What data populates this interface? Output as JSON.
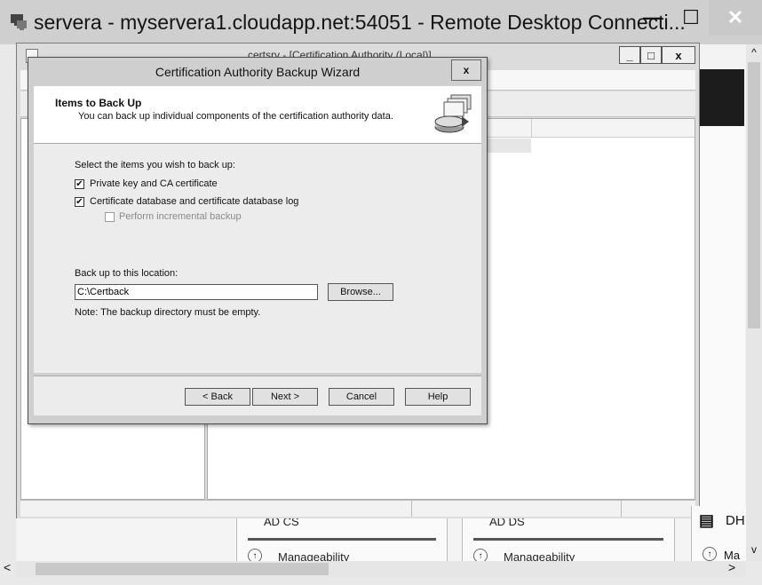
{
  "rdp_window": {
    "title": "servera - myservera1.cloudapp.net:54051 - Remote Desktop Connecti...",
    "min_glyph": "—",
    "max_glyph": "☐",
    "close_glyph": "✕"
  },
  "certsrv_window": {
    "title": "certsrv - [Certification Authority (Local)]",
    "min_glyph": "_",
    "max_glyph": "□",
    "close_glyph": "x"
  },
  "wizard": {
    "title": "Certification Authority Backup Wizard",
    "close_glyph": "x",
    "heading": "Items to Back Up",
    "subheading": "You can back up individual components of the certification authority data.",
    "select_prompt": "Select the items you wish to back up:",
    "items": [
      {
        "label": "Private key and CA certificate",
        "checked": "✔",
        "enabled": true
      },
      {
        "label": "Certificate database and certificate database log",
        "checked": "✔",
        "enabled": true
      },
      {
        "label": "Perform incremental backup",
        "checked": "",
        "enabled": false
      }
    ],
    "location_label": "Back up to this location:",
    "location_value": "C:\\Certback",
    "browse_label": "Browse...",
    "note": "Note: The backup directory must be empty.",
    "buttons": {
      "back": "< Back",
      "next": "Next >",
      "cancel": "Cancel",
      "help": "Help"
    }
  },
  "tiles": [
    {
      "heading": "AD CS",
      "sub": "Manageability"
    },
    {
      "heading": "AD DS",
      "sub": "Manageability"
    },
    {
      "heading": "DH",
      "sub": "Ma"
    }
  ],
  "scrollbars": {
    "up": "^",
    "down": "v",
    "left": "<",
    "right": ">"
  }
}
